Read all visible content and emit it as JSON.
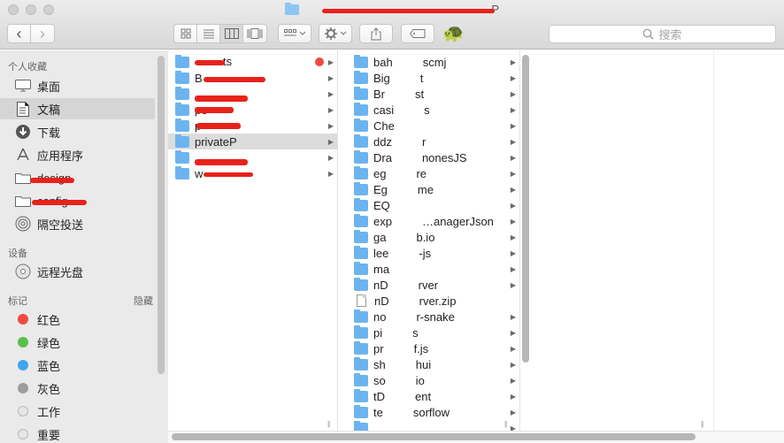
{
  "window": {
    "title_tail": "P"
  },
  "toolbar": {
    "back_glyph": "‹",
    "forward_glyph": "›",
    "tortoise": "🐢",
    "search_placeholder": "搜索"
  },
  "sidebar": {
    "favorites_header": "个人收藏",
    "favorites": [
      {
        "label": "桌面",
        "icon": "desktop-icon"
      },
      {
        "label": "文稿",
        "icon": "documents-icon",
        "selected": true
      },
      {
        "label": "下载",
        "icon": "downloads-icon"
      },
      {
        "label": "应用程序",
        "icon": "applications-icon"
      },
      {
        "label": "design",
        "icon": "folder-icon"
      },
      {
        "label": "config",
        "icon": "folder-icon"
      },
      {
        "label": "隔空投送",
        "icon": "airdrop-icon"
      }
    ],
    "devices_header": "设备",
    "devices": [
      {
        "label": "远程光盘",
        "icon": "remote-disc-icon"
      }
    ],
    "tags_header": "标记",
    "tags_hide": "隐藏",
    "tags": [
      {
        "label": "红色",
        "color": "#f04b43"
      },
      {
        "label": "绿色",
        "color": "#5ac04d"
      },
      {
        "label": "蓝色",
        "color": "#3da6ee"
      },
      {
        "label": "灰色",
        "color": "#9d9d9d"
      },
      {
        "label": "工作",
        "color": "#e2e2e2"
      },
      {
        "label": "重要",
        "color": "#e2e2e2"
      }
    ]
  },
  "column1": {
    "items": [
      {
        "label": "ts",
        "has_tag": true
      },
      {
        "label": "B"
      },
      {
        "label": ""
      },
      {
        "label": "pe"
      },
      {
        "label": "p"
      },
      {
        "label": "privateP",
        "selected": true
      },
      {
        "label": ""
      },
      {
        "label": "w"
      }
    ]
  },
  "column2": {
    "items": [
      {
        "label": "bah",
        "tail": "scmj",
        "type": "folder"
      },
      {
        "label": "Big",
        "tail": "t",
        "type": "folder"
      },
      {
        "label": "Br",
        "tail": "st",
        "type": "folder"
      },
      {
        "label": "casi",
        "tail": "s",
        "type": "folder"
      },
      {
        "label": "Che",
        "tail": "",
        "type": "folder"
      },
      {
        "label": "ddz",
        "tail": "r",
        "type": "folder"
      },
      {
        "label": "Dra",
        "tail": "nonesJS",
        "type": "folder"
      },
      {
        "label": "eg",
        "tail": "re",
        "type": "folder"
      },
      {
        "label": "Eg",
        "tail": "me",
        "type": "folder"
      },
      {
        "label": "EQ",
        "tail": "",
        "type": "folder"
      },
      {
        "label": "exp",
        "tail": "…anagerJson",
        "type": "folder"
      },
      {
        "label": "ga",
        "tail": "b.io",
        "type": "folder"
      },
      {
        "label": "lee",
        "tail": "-js",
        "type": "folder"
      },
      {
        "label": "ma",
        "tail": "",
        "type": "folder"
      },
      {
        "label": "nD",
        "tail": "rver",
        "type": "folder"
      },
      {
        "label": "nD",
        "tail": "rver.zip",
        "type": "file"
      },
      {
        "label": "no",
        "tail": "r-snake",
        "type": "folder"
      },
      {
        "label": "pi",
        "tail": "s",
        "type": "folder"
      },
      {
        "label": "pr",
        "tail": "f.js",
        "type": "folder"
      },
      {
        "label": "sh",
        "tail": "hui",
        "type": "folder"
      },
      {
        "label": "so",
        "tail": "io",
        "type": "folder"
      },
      {
        "label": "tD",
        "tail": "ent",
        "type": "folder"
      },
      {
        "label": "te",
        "tail": "sorflow",
        "type": "folder"
      },
      {
        "label": "",
        "tail": "",
        "type": "folder"
      }
    ]
  }
}
